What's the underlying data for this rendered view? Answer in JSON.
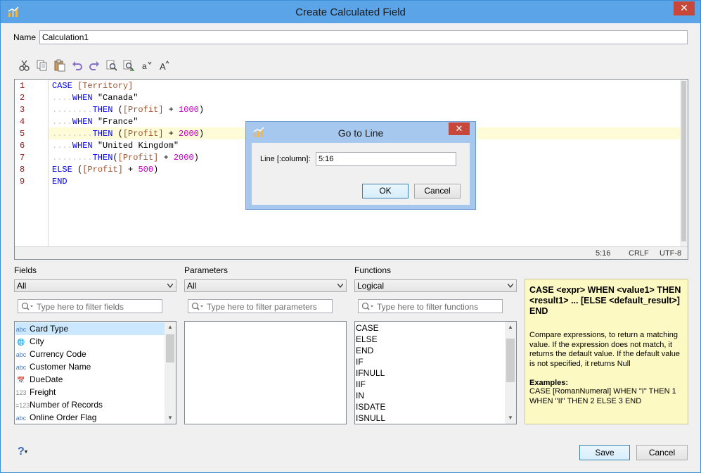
{
  "window": {
    "title": "Create Calculated Field",
    "close_glyph": "✕"
  },
  "name": {
    "label": "Name",
    "value": "Calculation1"
  },
  "toolbar": {
    "icons": [
      "cut-icon",
      "copy-icon",
      "paste-icon",
      "undo-icon",
      "redo-icon",
      "find-icon",
      "find-replace-icon",
      "lowercase-icon",
      "uppercase-icon"
    ],
    "lowercase_glyph": "a",
    "uppercase_glyph": "A"
  },
  "editor": {
    "line_numbers": [
      "1",
      "2",
      "3",
      "4",
      "5",
      "6",
      "7",
      "8",
      "9"
    ],
    "current_line": 5,
    "status": {
      "position": "5:16",
      "line_ending": "CRLF",
      "encoding": "UTF-8"
    }
  },
  "fields": {
    "label": "Fields",
    "dropdown_value": "All",
    "filter_placeholder": "Type here to filter fields",
    "items": [
      {
        "type": "abc",
        "label": "Card Type"
      },
      {
        "type": "geo",
        "label": "City"
      },
      {
        "type": "abc",
        "label": "Currency Code"
      },
      {
        "type": "abc",
        "label": "Customer Name"
      },
      {
        "type": "date",
        "label": "DueDate"
      },
      {
        "type": "123",
        "label": "Freight"
      },
      {
        "type": "calc123",
        "label": "Number of Records"
      },
      {
        "type": "abc",
        "label": "Online Order Flag"
      }
    ]
  },
  "parameters": {
    "label": "Parameters",
    "dropdown_value": "All",
    "filter_placeholder": "Type here to filter parameters"
  },
  "functions": {
    "label": "Functions",
    "dropdown_value": "Logical",
    "filter_placeholder": "Type here to filter functions",
    "items": [
      "CASE",
      "ELSE",
      "END",
      "IF",
      "IFNULL",
      "IIF",
      "IN",
      "ISDATE",
      "ISNULL"
    ]
  },
  "help": {
    "syntax": "CASE <expr> WHEN <value1> THEN <result1> ... [ELSE <default_result>] END",
    "description": "Compare expressions, to return a matching value. If the expression does not match, it returns the default value. If the default value is not specified, it returns Null",
    "examples_title": "Examples:",
    "example": "CASE [RomanNumeral] WHEN \"I\" THEN 1 WHEN \"II\" THEN 2 ELSE 3 END"
  },
  "footer": {
    "help_glyph": "?",
    "save_label": "Save",
    "cancel_label": "Cancel"
  },
  "goto_dialog": {
    "title": "Go to Line",
    "close_glyph": "✕",
    "line_label": "Line [:column]:",
    "line_value": "5:16",
    "ok_label": "OK",
    "cancel_label": "Cancel"
  },
  "colors": {
    "titlebar": "#5ca4e8",
    "keyword": "#0000ff",
    "field_ref": "#a0522d",
    "number": "#c000c0",
    "line_number": "#a31515",
    "help_bg": "#fdf9c3",
    "selection": "#cce8ff"
  }
}
